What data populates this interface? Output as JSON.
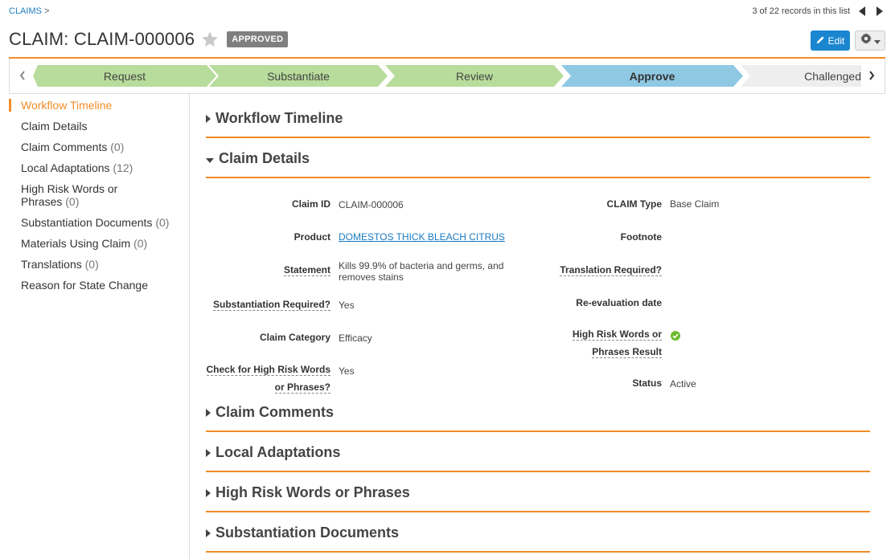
{
  "breadcrumb": {
    "root": "CLAIMS",
    "separator": ">"
  },
  "record_nav": {
    "text": "3 of 22 records in this list"
  },
  "header": {
    "title": "CLAIM: CLAIM-000006",
    "status_badge": "APPROVED",
    "edit_label": "Edit"
  },
  "workflow": {
    "stages": [
      {
        "label": "Request",
        "state": "done"
      },
      {
        "label": "Substantiate",
        "state": "done"
      },
      {
        "label": "Review",
        "state": "done"
      },
      {
        "label": "Approve",
        "state": "current"
      },
      {
        "label": "Challenged",
        "state": "pending"
      }
    ]
  },
  "sidebar": {
    "items": [
      {
        "label": "Workflow Timeline",
        "count": ""
      },
      {
        "label": "Claim Details",
        "count": ""
      },
      {
        "label": "Claim Comments",
        "count": "(0)"
      },
      {
        "label": "Local Adaptations",
        "count": "(12)"
      },
      {
        "label": "High Risk Words or",
        "label2": "Phrases",
        "count": "(0)"
      },
      {
        "label": "Substantiation Documents",
        "count": "(0)"
      },
      {
        "label": "Materials Using Claim",
        "count": "(0)"
      },
      {
        "label": "Translations",
        "count": "(0)"
      },
      {
        "label": "Reason for State Change",
        "count": ""
      }
    ]
  },
  "sections": {
    "workflow_timeline": "Workflow Timeline",
    "claim_details": "Claim Details",
    "claim_comments": "Claim Comments",
    "local_adaptations": "Local Adaptations",
    "high_risk_words": "High Risk Words or Phrases",
    "substantiation_documents": "Substantiation Documents"
  },
  "claim_details": {
    "claim_id": {
      "label": "Claim ID",
      "value": "CLAIM-000006"
    },
    "product": {
      "label": "Product",
      "value": "DOMESTOS THICK BLEACH CITRUS"
    },
    "statement": {
      "label": "Statement",
      "value_line1": "Kills 99.9% of bacteria and germs, and",
      "value_line2": "removes stains"
    },
    "substantiation_required": {
      "label": "Substantiation Required?",
      "value": "Yes"
    },
    "claim_category": {
      "label": "Claim Category",
      "value": "Efficacy"
    },
    "check_high_risk": {
      "label_line1": "Check for High Risk Words",
      "label_line2": "or Phrases?",
      "value": "Yes"
    },
    "claim_type": {
      "label": "CLAIM Type",
      "value": "Base Claim"
    },
    "footnote": {
      "label": "Footnote",
      "value": ""
    },
    "translation_required": {
      "label": "Translation Required?",
      "value": ""
    },
    "reevaluation_date": {
      "label": "Re-evaluation date",
      "value": ""
    },
    "high_risk_result": {
      "label_line1": "High Risk Words or",
      "label_line2": "Phrases Result",
      "icon": "green-check-icon"
    },
    "status": {
      "label": "Status",
      "value": "Active"
    }
  },
  "colors": {
    "accent": "#f28c28",
    "done_stage": "#b8dc9b",
    "current_stage": "#8fc8e3",
    "pending_stage": "#eeeeee",
    "link": "#1a7bc4",
    "edit_button": "#1a86d0"
  }
}
